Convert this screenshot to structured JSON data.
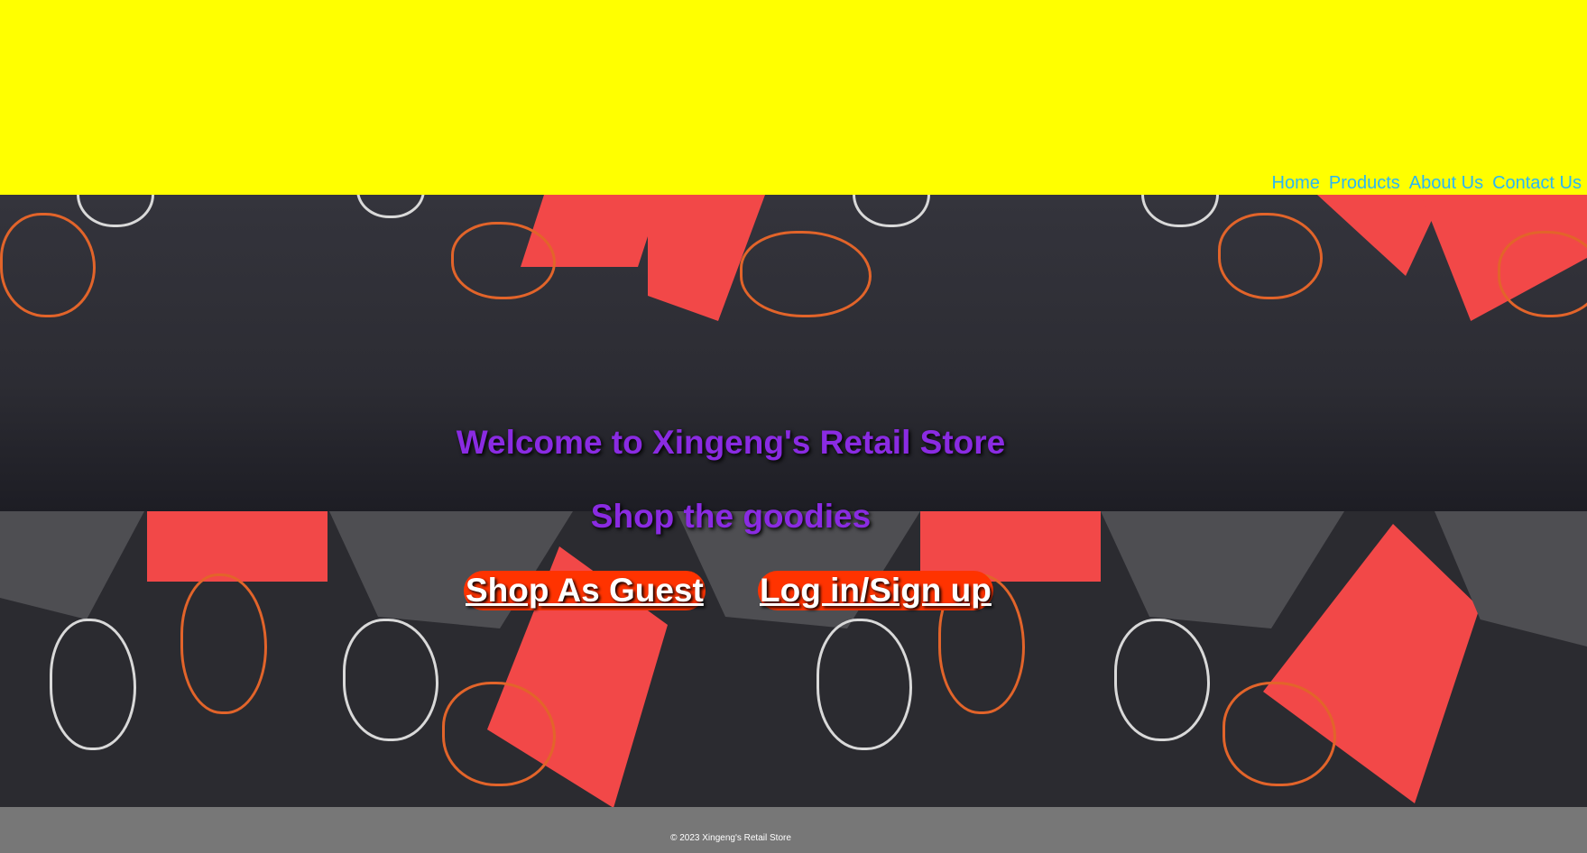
{
  "nav": {
    "items": [
      "Home",
      "Products",
      "About Us",
      "Contact Us"
    ]
  },
  "hero": {
    "title": "Welcome to Xingeng's Retail Store",
    "tagline": "Shop the goodies",
    "guest_button": "Shop As Guest",
    "login_button": "Log in/Sign up"
  },
  "footer": {
    "copyright": "© 2023 Xingeng's Retail Store"
  },
  "colors": {
    "header_bg": "#ffff00",
    "nav_link": "#29b6f6",
    "heading": "#8a2be2",
    "button_bg": "#ff3300",
    "footer_bg": "#777777"
  }
}
